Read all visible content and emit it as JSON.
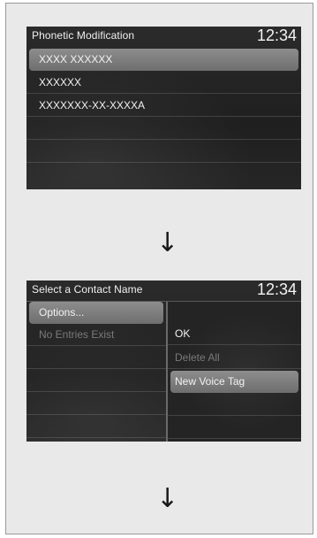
{
  "screen1": {
    "title": "Phonetic Modification",
    "clock": "12:34",
    "items": [
      {
        "label": "XXXX XXXXXX",
        "selected": true
      },
      {
        "label": "XXXXXX",
        "selected": false
      },
      {
        "label": "XXXXXXX-XX-XXXXA",
        "selected": false
      }
    ]
  },
  "screen2": {
    "title": "Select a Contact Name",
    "clock": "12:34",
    "left_items": [
      {
        "label": "Options...",
        "selected": true
      },
      {
        "label": "No Entries Exist",
        "enabled": false
      }
    ],
    "right_items": [
      {
        "label": "OK",
        "enabled": true
      },
      {
        "label": "Delete All",
        "enabled": false
      },
      {
        "label": "New Voice Tag",
        "selected": true
      }
    ]
  },
  "arrows": [
    "↓",
    "↓"
  ]
}
